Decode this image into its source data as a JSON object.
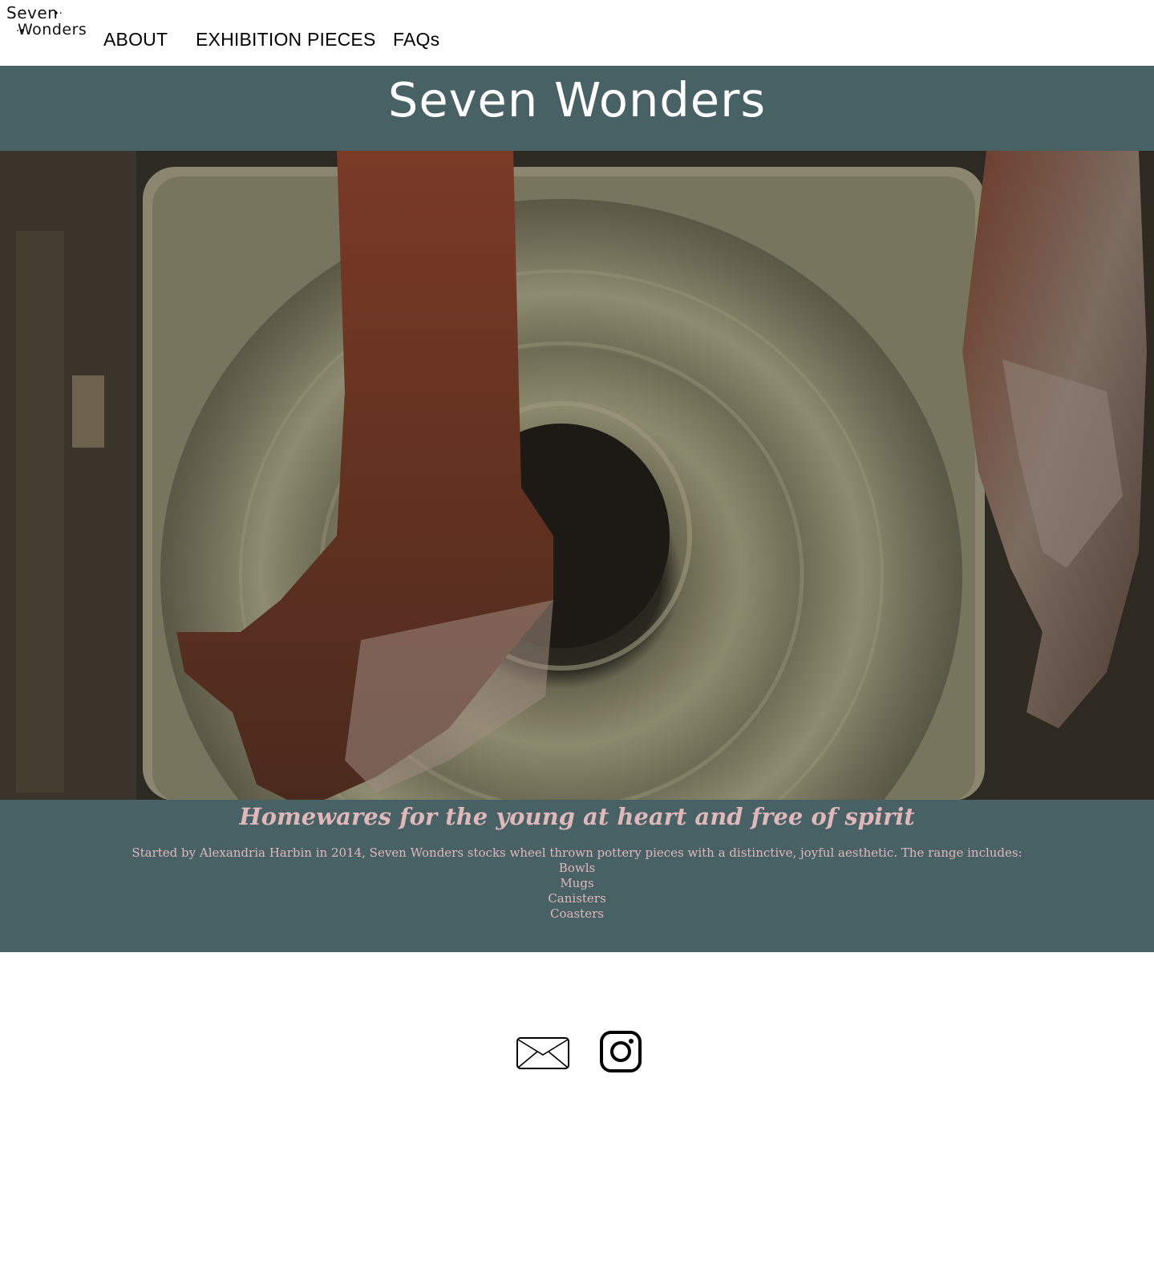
{
  "logo": {
    "line1": "Seven",
    "line2": "Wonders",
    "dots1": "•·",
    "dots2": "·•"
  },
  "nav": {
    "items": [
      {
        "label": "ABOUT"
      },
      {
        "label": "EXHIBITION PIECES"
      },
      {
        "label": "FAQs"
      }
    ]
  },
  "header": {
    "title": "Seven Wonders"
  },
  "hero": {
    "icon": "pottery-wheel-image"
  },
  "info": {
    "tagline": "Homewares for the young at heart and free of spirit",
    "description": "Started by Alexandria Harbin in 2014, Seven Wonders stocks wheel thrown pottery pieces with a distinctive, joyful aesthetic. The range includes:",
    "range": [
      "Bowls",
      "Mugs",
      "Canisters",
      "Coasters"
    ]
  },
  "footer": {
    "icons": [
      "mail-icon",
      "instagram-icon"
    ]
  },
  "colors": {
    "band": "#476165",
    "title_text": "#ffffff",
    "info_text": "#e0b8b9",
    "background": "#ffffff"
  }
}
